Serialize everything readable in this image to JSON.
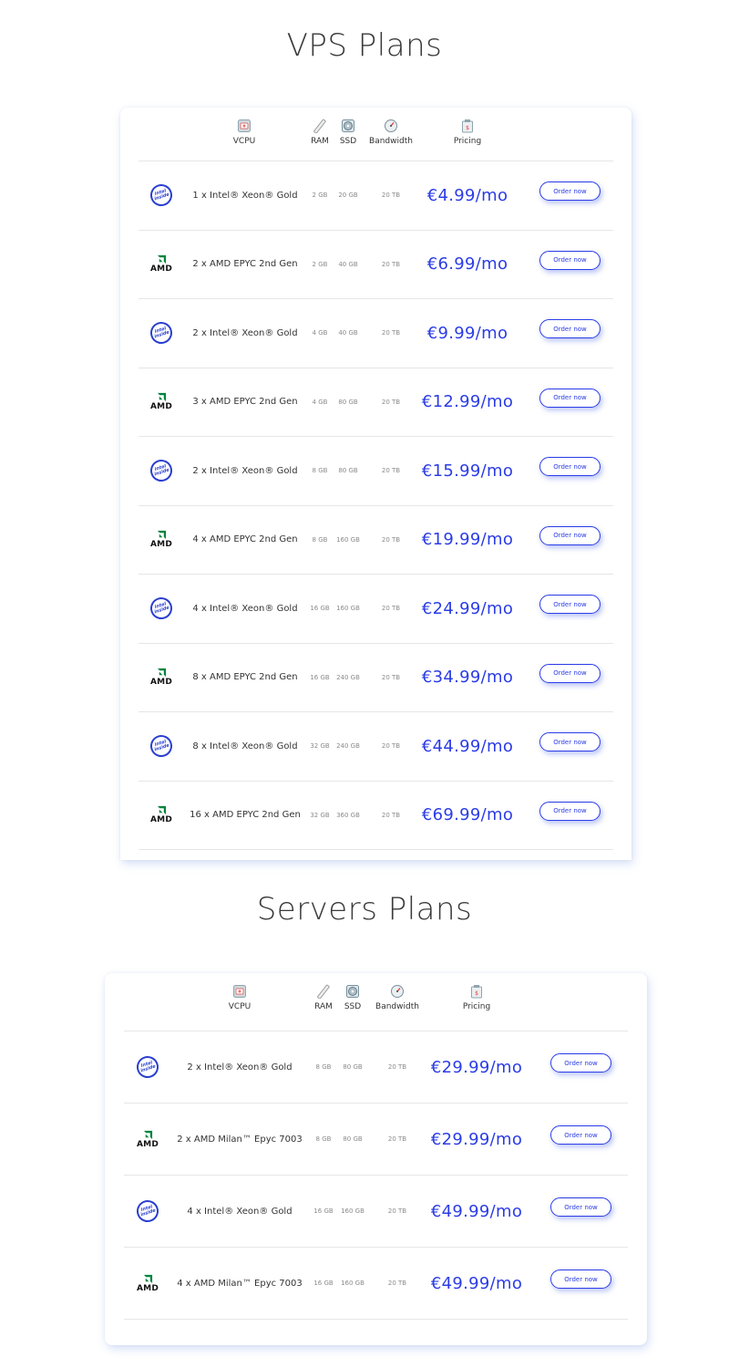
{
  "vps": {
    "title": "VPS Plans",
    "headers": {
      "vcpu": "VCPU",
      "ram": "RAM",
      "ssd": "SSD",
      "bandwidth": "Bandwidth",
      "pricing": "Pricing"
    },
    "rows": [
      {
        "brand": "intel",
        "cpu": "1 x Intel® Xeon® Gold",
        "ram": "2 GB",
        "ssd": "20 GB",
        "bandwidth": "20 TB",
        "price": "€4.99/mo",
        "button": "Order now"
      },
      {
        "brand": "amd",
        "cpu": "2 x AMD EPYC 2nd Gen",
        "ram": "2 GB",
        "ssd": "40 GB",
        "bandwidth": "20 TB",
        "price": "€6.99/mo",
        "button": "Order now"
      },
      {
        "brand": "intel",
        "cpu": "2 x Intel® Xeon® Gold",
        "ram": "4 GB",
        "ssd": "40 GB",
        "bandwidth": "20 TB",
        "price": "€9.99/mo",
        "button": "Order now"
      },
      {
        "brand": "amd",
        "cpu": "3 x AMD EPYC 2nd Gen",
        "ram": "4 GB",
        "ssd": "80 GB",
        "bandwidth": "20 TB",
        "price": "€12.99/mo",
        "button": "Order now"
      },
      {
        "brand": "intel",
        "cpu": "2 x Intel® Xeon® Gold",
        "ram": "8 GB",
        "ssd": "80 GB",
        "bandwidth": "20 TB",
        "price": "€15.99/mo",
        "button": "Order now"
      },
      {
        "brand": "amd",
        "cpu": "4 x AMD EPYC 2nd Gen",
        "ram": "8 GB",
        "ssd": "160 GB",
        "bandwidth": "20 TB",
        "price": "€19.99/mo",
        "button": "Order now"
      },
      {
        "brand": "intel",
        "cpu": "4 x Intel® Xeon® Gold",
        "ram": "16 GB",
        "ssd": "160 GB",
        "bandwidth": "20 TB",
        "price": "€24.99/mo",
        "button": "Order now"
      },
      {
        "brand": "amd",
        "cpu": "8 x AMD EPYC 2nd Gen",
        "ram": "16 GB",
        "ssd": "240 GB",
        "bandwidth": "20 TB",
        "price": "€34.99/mo",
        "button": "Order now"
      },
      {
        "brand": "intel",
        "cpu": "8 x Intel® Xeon® Gold",
        "ram": "32 GB",
        "ssd": "240 GB",
        "bandwidth": "20 TB",
        "price": "€44.99/mo",
        "button": "Order now"
      },
      {
        "brand": "amd",
        "cpu": "16 x AMD EPYC 2nd Gen",
        "ram": "32 GB",
        "ssd": "360 GB",
        "bandwidth": "20 TB",
        "price": "€69.99/mo",
        "button": "Order now"
      }
    ]
  },
  "servers": {
    "title": "Servers Plans",
    "headers": {
      "vcpu": "VCPU",
      "ram": "RAM",
      "ssd": "SSD",
      "bandwidth": "Bandwidth",
      "pricing": "Pricing"
    },
    "rows": [
      {
        "brand": "intel",
        "cpu": "2 x Intel® Xeon® Gold",
        "ram": "8 GB",
        "ssd": "80 GB",
        "bandwidth": "20 TB",
        "price": "€29.99/mo",
        "button": "Order now"
      },
      {
        "brand": "amd",
        "cpu": "2 x AMD Milan™ Epyc 7003",
        "ram": "8 GB",
        "ssd": "80 GB",
        "bandwidth": "20 TB",
        "price": "€29.99/mo",
        "button": "Order now"
      },
      {
        "brand": "intel",
        "cpu": "4 x Intel® Xeon® Gold",
        "ram": "16 GB",
        "ssd": "160 GB",
        "bandwidth": "20 TB",
        "price": "€49.99/mo",
        "button": "Order now"
      },
      {
        "brand": "amd",
        "cpu": "4 x AMD Milan™ Epyc 7003",
        "ram": "16 GB",
        "ssd": "160 GB",
        "bandwidth": "20 TB",
        "price": "€49.99/mo",
        "button": "Order now"
      }
    ]
  },
  "logos": {
    "intel_text": "intel inside",
    "amd_text": "AMD"
  },
  "colors": {
    "accent": "#2b3ce6",
    "amd_green": "#00843d",
    "intel_blue": "#2a3fd0"
  }
}
